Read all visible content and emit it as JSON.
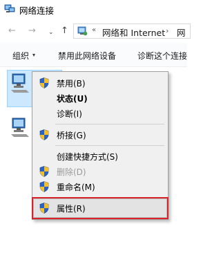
{
  "window": {
    "title": "网络连接"
  },
  "nav": {
    "back_glyph": "←",
    "forward_glyph": "→",
    "recent_glyph": "⌄",
    "up_glyph": "↑"
  },
  "address": {
    "overflow_glyph": "«",
    "segment": "网络和 Internet",
    "separator": "›",
    "segment_partial": "网"
  },
  "commandbar": {
    "organize": "组织",
    "organize_arrow": "▾",
    "disable": "禁用此网络设备",
    "diagnose": "诊断这个连接"
  },
  "menu": {
    "items": [
      {
        "label": "禁用(B)",
        "shield": true,
        "bold": false,
        "disabled": false
      },
      {
        "label": "状态(U)",
        "shield": false,
        "bold": true,
        "disabled": false
      },
      {
        "label": "诊断(I)",
        "shield": false,
        "bold": false,
        "disabled": false
      },
      {
        "label": "桥接(G)",
        "shield": true,
        "bold": false,
        "disabled": false
      },
      {
        "label": "创建快捷方式(S)",
        "shield": false,
        "bold": false,
        "disabled": false
      },
      {
        "label": "删除(D)",
        "shield": true,
        "bold": false,
        "disabled": true
      },
      {
        "label": "重命名(M)",
        "shield": true,
        "bold": false,
        "disabled": false
      },
      {
        "label": "属性(R)",
        "shield": true,
        "bold": false,
        "disabled": false,
        "highlighted": true
      }
    ]
  },
  "colors": {
    "highlight_border": "#d8232a",
    "selection_bg": "#cce8ff",
    "menu_bg": "#f0f0f0"
  }
}
